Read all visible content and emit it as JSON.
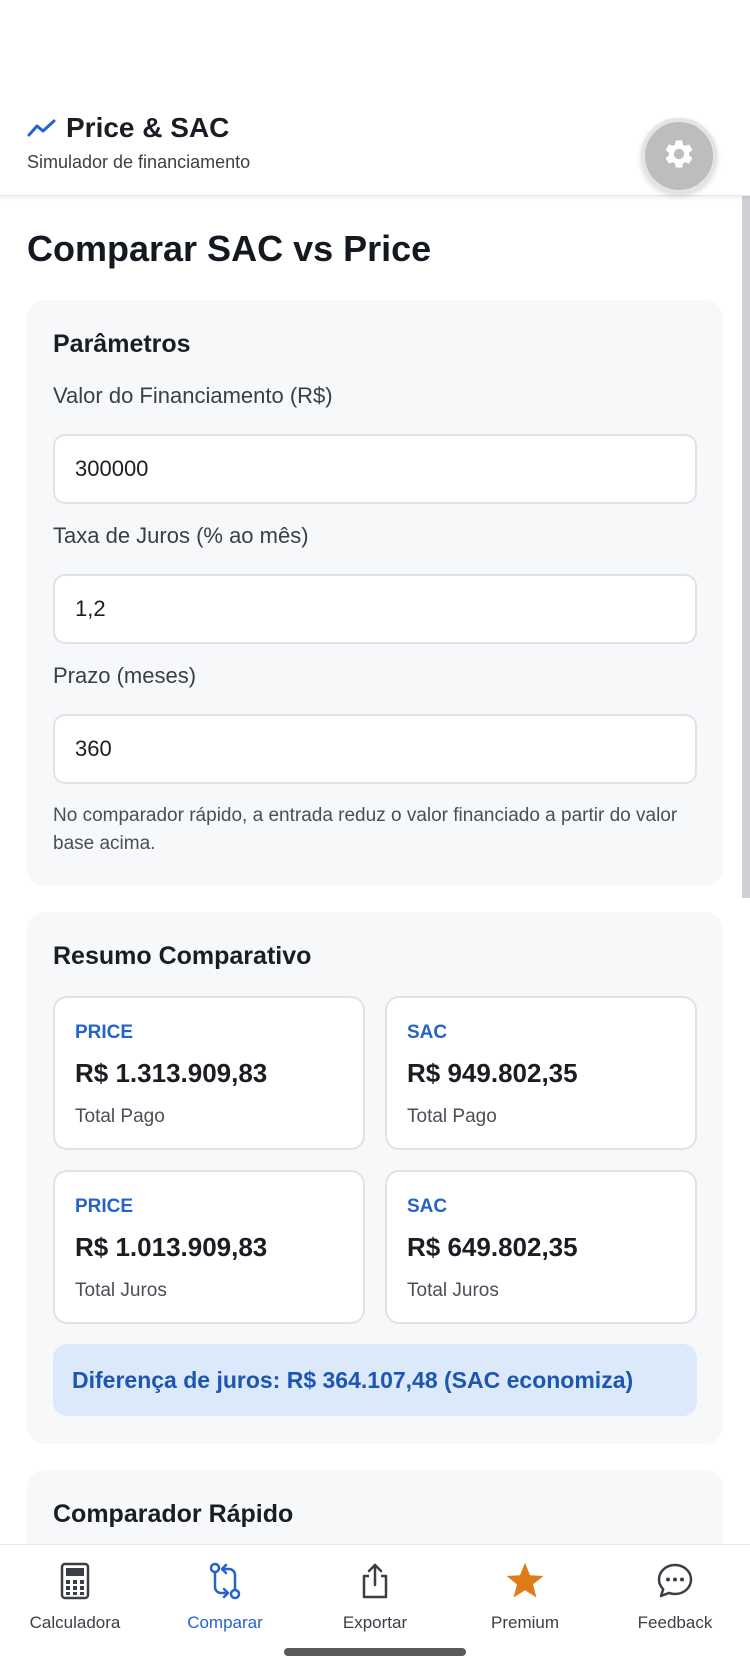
{
  "header": {
    "title": "Price & SAC",
    "subtitle": "Simulador de financiamento",
    "brand_icon": "trending-line-icon",
    "settings_icon": "gear-icon"
  },
  "page": {
    "title": "Comparar SAC vs Price"
  },
  "parameters": {
    "title": "Parâmetros",
    "amount_label": "Valor do Financiamento (R$)",
    "amount_value": "300000",
    "rate_label": "Taxa de Juros (% ao mês)",
    "rate_value": "1,2",
    "term_label": "Prazo (meses)",
    "term_value": "360",
    "hint": "No comparador rápido, a entrada reduz o valor financiado a partir do valor base acima."
  },
  "summary": {
    "title": "Resumo Comparativo",
    "cards": [
      {
        "tag": "PRICE",
        "value": "R$ 1.313.909,83",
        "caption": "Total Pago"
      },
      {
        "tag": "SAC",
        "value": "R$ 949.802,35",
        "caption": "Total Pago"
      },
      {
        "tag": "PRICE",
        "value": "R$ 1.013.909,83",
        "caption": "Total Juros"
      },
      {
        "tag": "SAC",
        "value": "R$ 649.802,35",
        "caption": "Total Juros"
      }
    ],
    "difference": "Diferença de juros: R$ 364.107,48 (SAC economiza)"
  },
  "quick": {
    "title": "Comparador Rápido"
  },
  "nav": {
    "items": [
      {
        "label": "Calculadora",
        "icon": "calculator-icon",
        "active": false
      },
      {
        "label": "Comparar",
        "icon": "compare-arrows-icon",
        "active": true
      },
      {
        "label": "Exportar",
        "icon": "share-upload-icon",
        "active": false
      },
      {
        "label": "Premium",
        "icon": "star-icon",
        "active": false
      },
      {
        "label": "Feedback",
        "icon": "chat-bubble-icon",
        "active": false
      }
    ]
  },
  "colors": {
    "accent": "#2563c9",
    "premium_star": "#e07b1a",
    "banner_bg": "#dbe9fb",
    "card_bg": "#f7f8fa"
  }
}
